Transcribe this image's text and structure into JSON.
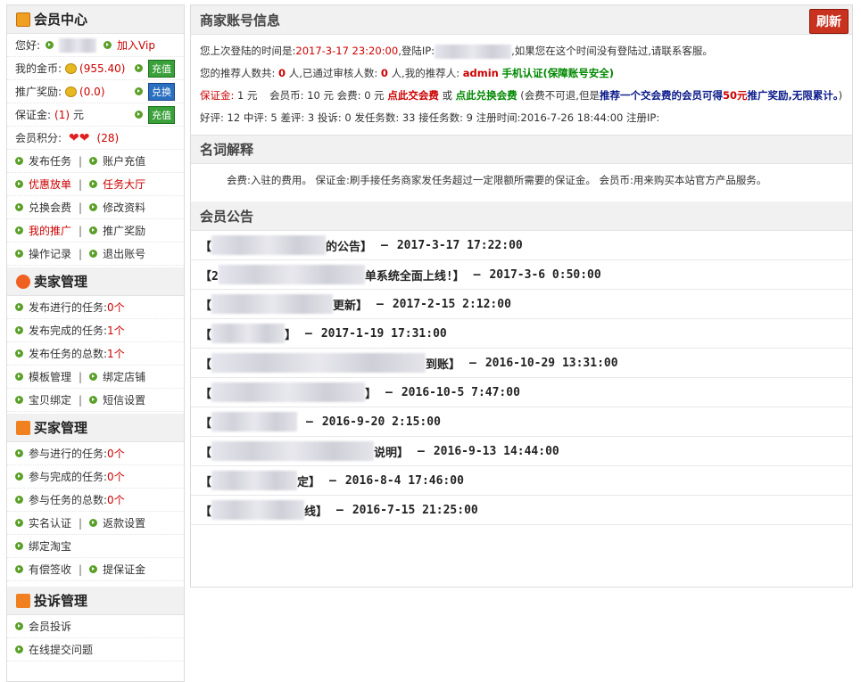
{
  "sidebar": {
    "member": {
      "title": "会员中心",
      "hello_label": "您好:",
      "vip_link": "加入Vip",
      "gold_label": "我的金币:",
      "gold_value": "(955.40)",
      "recharge": "充值",
      "promo_label": "推广奖励:",
      "promo_value": "(0.0)",
      "exchange": "兑换",
      "deposit_label": "保证金:",
      "deposit_value": "(1)",
      "deposit_unit": "元",
      "deposit_btn": "充值",
      "points_label": "会员积分:",
      "points_value": "(28)",
      "links": [
        [
          "发布任务",
          "账户充值"
        ],
        [
          "优惠放单",
          "任务大厅"
        ],
        [
          "兑换会费",
          "修改资料"
        ],
        [
          "我的推广",
          "推广奖励"
        ],
        [
          "操作记录",
          "退出账号"
        ]
      ]
    },
    "seller": {
      "title": "卖家管理",
      "stats": [
        {
          "label": "发布进行的任务:",
          "value": "0",
          "unit": "个"
        },
        {
          "label": "发布完成的任务:",
          "value": "1",
          "unit": "个"
        },
        {
          "label": "发布任务的总数:",
          "value": "1",
          "unit": "个"
        }
      ],
      "links": [
        [
          "模板管理",
          "绑定店铺"
        ],
        [
          "宝贝绑定",
          "短信设置"
        ]
      ]
    },
    "buyer": {
      "title": "买家管理",
      "stats": [
        {
          "label": "参与进行的任务:",
          "value": "0",
          "unit": "个"
        },
        {
          "label": "参与完成的任务:",
          "value": "0",
          "unit": "个"
        },
        {
          "label": "参与任务的总数:",
          "value": "0",
          "unit": "个"
        }
      ],
      "links": [
        [
          "实名认证",
          "返款设置"
        ],
        [
          "绑定淘宝"
        ],
        [
          "有偿签收",
          "提保证金"
        ]
      ]
    },
    "complaint": {
      "title": "投诉管理",
      "links": [
        "会员投诉",
        "在线提交问题"
      ]
    }
  },
  "main": {
    "account_title": "商家账号信息",
    "refresh": "刷新",
    "last_login_label": "您上次登陆的时间是:",
    "last_login_time": "2017-3-17 23:20:00",
    "login_ip_label": ",登陆IP:",
    "login_ip_tail": ",如果您在这个时间没有登陆过,请联系客服。",
    "ref_count_label": "您的推荐人数共:",
    "ref_count": "0",
    "ref_passed_label": "人,已通过审核人数:",
    "ref_passed": "0",
    "ref_person_label": "人,我的推荐人:",
    "ref_person": "admin",
    "phone_auth": "手机认证(保障账号安全)",
    "deposit_label": "保证金:",
    "deposit_text": "1 元",
    "coin_label": "会员币:",
    "coin_text": "10 元",
    "fee_label": "会费:",
    "fee_text": "0 元",
    "pay_fee_link": "点此交会费",
    "or": "或",
    "exchange_fee_link": "点此兑换会费",
    "fee_note": "(会费不可退,但是",
    "recommend_a": "推荐一个交会费的会员可得",
    "recommend_amount": "50元",
    "recommend_b": "推广奖励,无限累计。",
    "recommend_close": ")",
    "stats_line": "好评: 12 中评: 5 差评: 3 投诉: 0 发任务数: 33 接任务数: 9 注册时间:2016-7-26 18:44:00 注册IP:",
    "terms_title": "名词解释",
    "terms_text": "会费:入驻的费用。 保证金:刷手接任务商家发任务超过一定限额所需要的保证金。 会员币:用来购买本站官方产品服务。",
    "notice_title": "会员公告",
    "notices": [
      {
        "pre": "【",
        "post": "的公告】",
        "date": "2017-3-17 17:22:00"
      },
      {
        "pre": "【2",
        "post": "单系统全面上线!】",
        "date": "2017-3-6 0:50:00"
      },
      {
        "pre": "【",
        "post": "更新】",
        "date": "2017-2-15 2:12:00"
      },
      {
        "pre": "【",
        "post": "】",
        "date": "2017-1-19 17:31:00"
      },
      {
        "pre": "【",
        "post": "到账】",
        "date": "2016-10-29 13:31:00"
      },
      {
        "pre": "【",
        "post": "】",
        "date": "2016-10-5 7:47:00"
      },
      {
        "pre": "【",
        "post": "",
        "date": "2016-9-20 2:15:00"
      },
      {
        "pre": "【",
        "post": "说明】",
        "date": "2016-9-13 14:44:00"
      },
      {
        "pre": "【",
        "post": "定】",
        "date": "2016-8-4 17:46:00"
      },
      {
        "pre": "【",
        "post": "线】",
        "date": "2016-7-15 21:25:00"
      }
    ],
    "notice_dash": "—"
  }
}
